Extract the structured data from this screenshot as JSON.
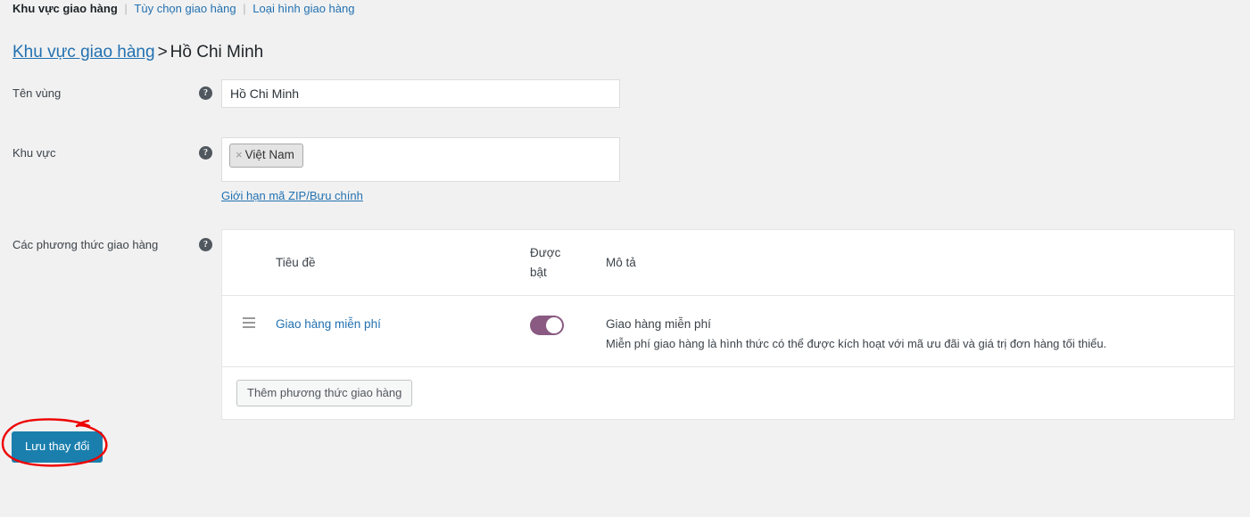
{
  "subnav": {
    "items": [
      {
        "label": "Khu vực giao hàng",
        "active": true
      },
      {
        "label": "Tùy chọn giao hàng",
        "active": false
      },
      {
        "label": "Loại hình giao hàng",
        "active": false
      }
    ],
    "separator": "|"
  },
  "breadcrumb": {
    "parent": "Khu vực giao hàng",
    "separator": ">",
    "current": "Hồ Chi Minh"
  },
  "form": {
    "zone_name": {
      "label": "Tên vùng",
      "help": "?",
      "value": "Hồ Chi Minh",
      "placeholder": ""
    },
    "zone_regions": {
      "label": "Khu vực",
      "help": "?",
      "chips": [
        {
          "remove": "×",
          "label": "Việt Nam"
        }
      ],
      "zip_link": "Giới hạn mã ZIP/Bưu chính"
    },
    "shipping_methods": {
      "label": "Các phương thức giao hàng",
      "help": "?"
    }
  },
  "methods_table": {
    "headers": {
      "handle": "",
      "title": "Tiêu đề",
      "enabled": "Được bật",
      "description": "Mô tả"
    },
    "rows": [
      {
        "handle_icon": "drag-handle-icon",
        "title": "Giao hàng miễn phí",
        "enabled": true,
        "desc_title": "Giao hàng miễn phí",
        "desc_body": "Miễn phí giao hàng là hình thức có thể được kích hoạt với mã ưu đãi và giá trị đơn hàng tối thiểu."
      }
    ],
    "add_button": "Thêm phương thức giao hàng"
  },
  "actions": {
    "save": "Lưu thay đổi"
  },
  "annotation": {
    "shape": "hand-drawn-red-ellipse",
    "color": "#ee0000",
    "target": "save-button"
  },
  "colors": {
    "page_background": "#f1f1f1",
    "link": "#2271b1",
    "primary_button": "#1a7fad",
    "toggle_on": "#8a5a82",
    "annotation_red": "#ee0000"
  }
}
